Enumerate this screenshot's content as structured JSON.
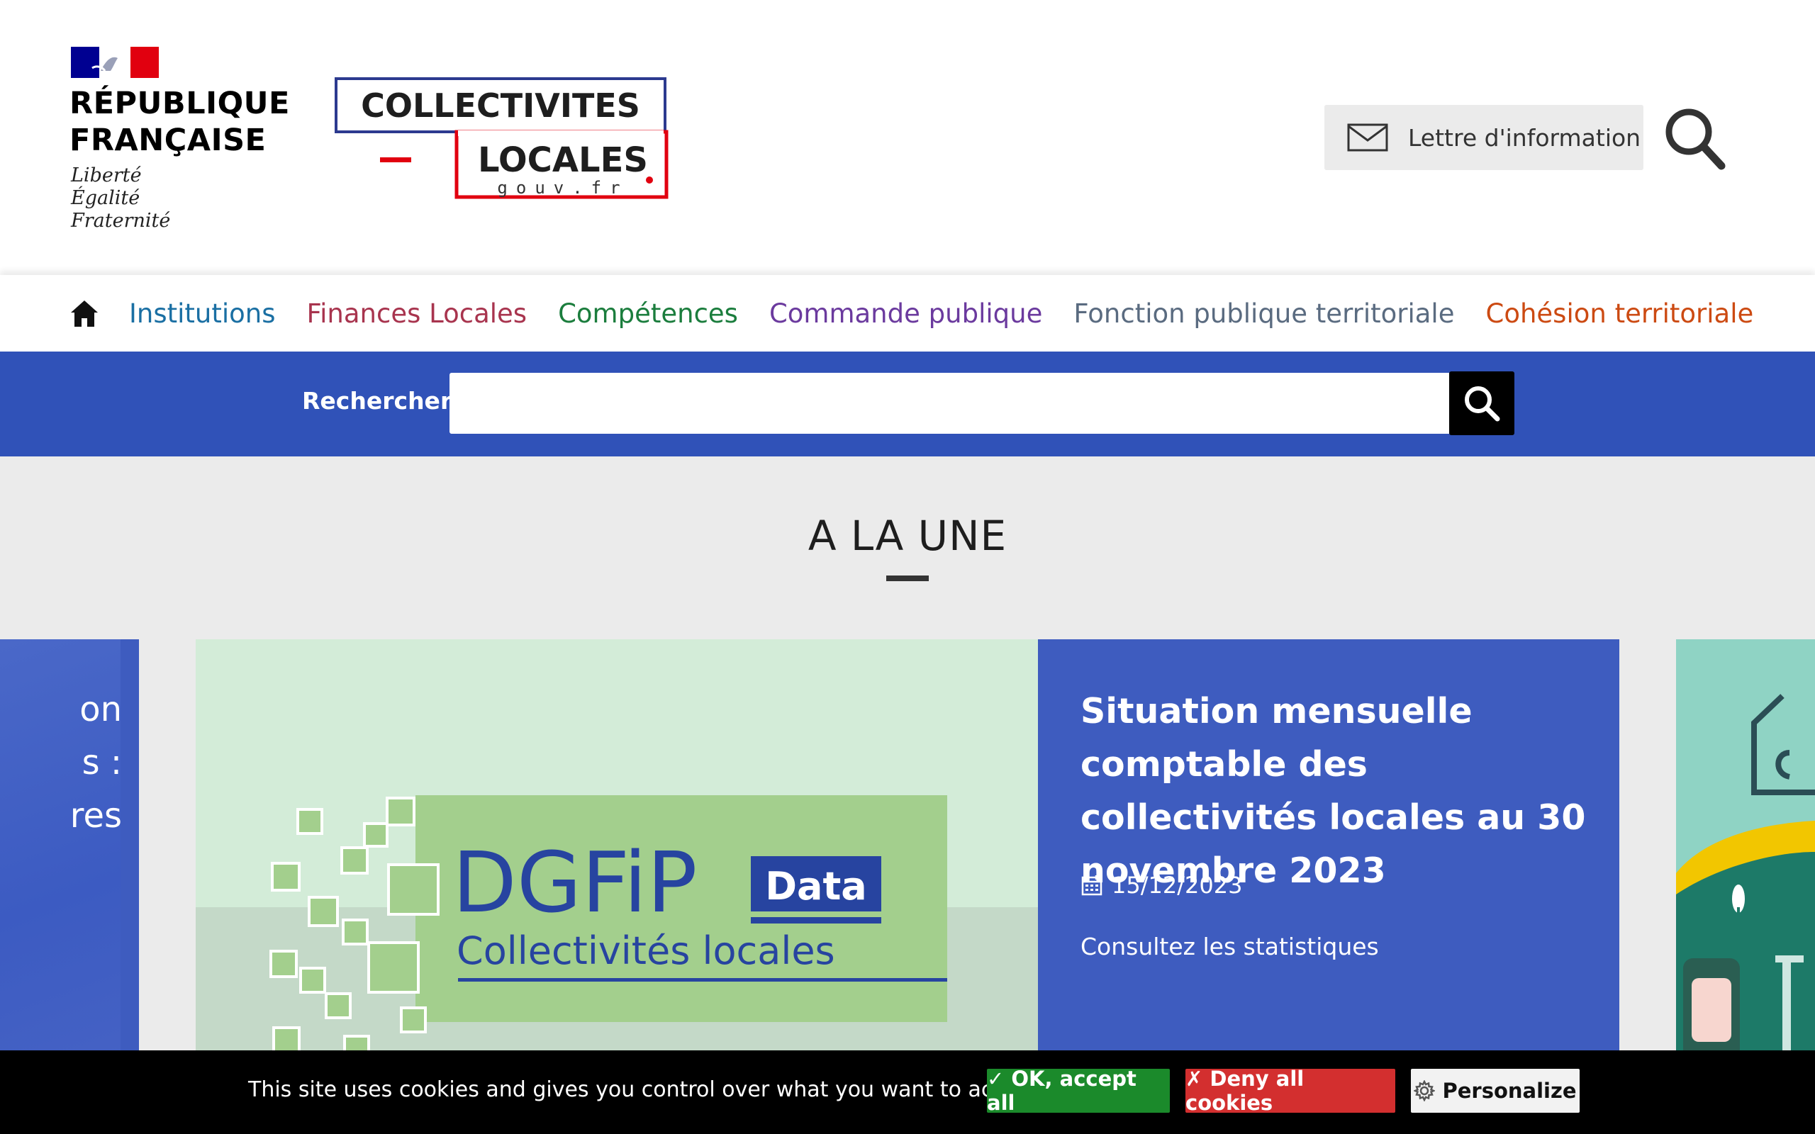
{
  "header": {
    "republique_lines": [
      "RÉPUBLIQUE",
      "FRANÇAISE"
    ],
    "motto_lines": [
      "Liberté",
      "Égalité",
      "Fraternité"
    ],
    "brand": {
      "line1": "COLLECTIVITES",
      "line2": "LOCALES",
      "domain": "gouv.fr"
    },
    "newsletter_label": "Lettre d'information",
    "search_icon": "search-icon"
  },
  "nav": {
    "home_icon": "home-icon",
    "items": [
      {
        "label": "Institutions",
        "color": "#1a6fa3"
      },
      {
        "label": "Finances Locales",
        "color": "#a8344e"
      },
      {
        "label": "Compétences",
        "color": "#1b7d3d"
      },
      {
        "label": "Commande publique",
        "color": "#6b3a9e"
      },
      {
        "label": "Fonction publique territoriale",
        "color": "#5a6b80"
      },
      {
        "label": "Cohésion territoriale",
        "color": "#cc4a12"
      }
    ]
  },
  "search": {
    "label": "Rechercher",
    "value": "",
    "placeholder": ""
  },
  "une": {
    "title": "A LA UNE",
    "left_card_fragments": [
      "on",
      "s :",
      "res"
    ],
    "main_card": {
      "image_logo_main": "DGFiP",
      "image_logo_badge": "Data",
      "image_logo_sub": "Collectivités locales",
      "title": "Situation mensuelle comptable des collectivités locales au 30 novembre 2023",
      "date": "15/12/2023",
      "link": "Consultez les statistiques"
    }
  },
  "cookies": {
    "text": "This site uses cookies and gives you control over what you want to activate",
    "accept_label": "✓ OK, accept all",
    "deny_label": "✗ Deny all cookies",
    "personalize_label": "Personalize"
  },
  "colors": {
    "primary_blue": "#3052b8",
    "card_blue": "#3e5cbf",
    "accept_green": "#1b8a2b",
    "deny_red": "#d32f2f"
  }
}
